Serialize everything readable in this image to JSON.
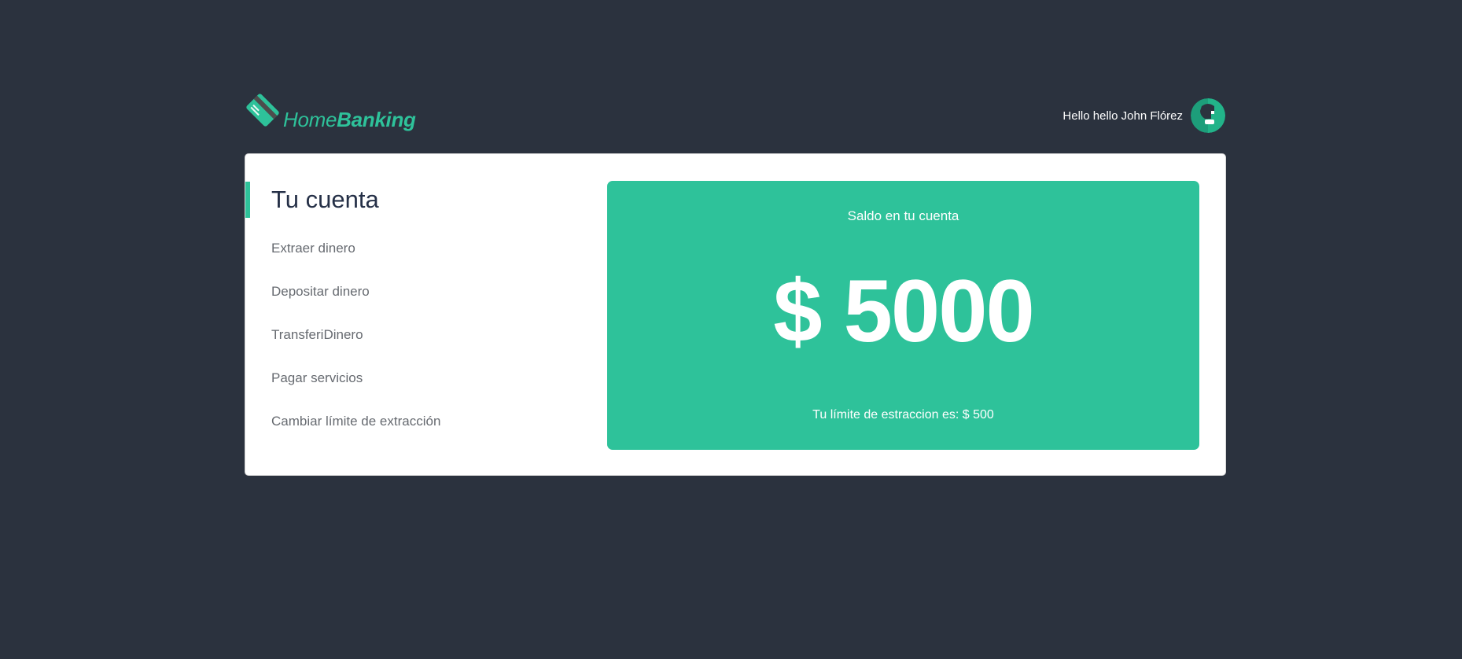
{
  "brand": {
    "name_part1": "Home",
    "name_part2": "Banking",
    "accent_color": "#2ec29a",
    "icon": "credit-card-icon"
  },
  "user": {
    "greeting": "Hello hello John Flórez",
    "avatar_icon": "user-avatar-icon"
  },
  "account": {
    "title": "Tu cuenta",
    "menu": [
      {
        "label": "Extraer dinero"
      },
      {
        "label": "Depositar dinero"
      },
      {
        "label": "TransferiDinero"
      },
      {
        "label": "Pagar servicios"
      },
      {
        "label": "Cambiar límite de extracción"
      }
    ]
  },
  "balance": {
    "label": "Saldo en tu cuenta",
    "amount": "$ 5000",
    "limit_text": "Tu límite de estraccion es: $ 500"
  },
  "colors": {
    "background": "#2b323e",
    "card": "#ffffff",
    "title": "#253047",
    "menu_text": "#666a70"
  }
}
